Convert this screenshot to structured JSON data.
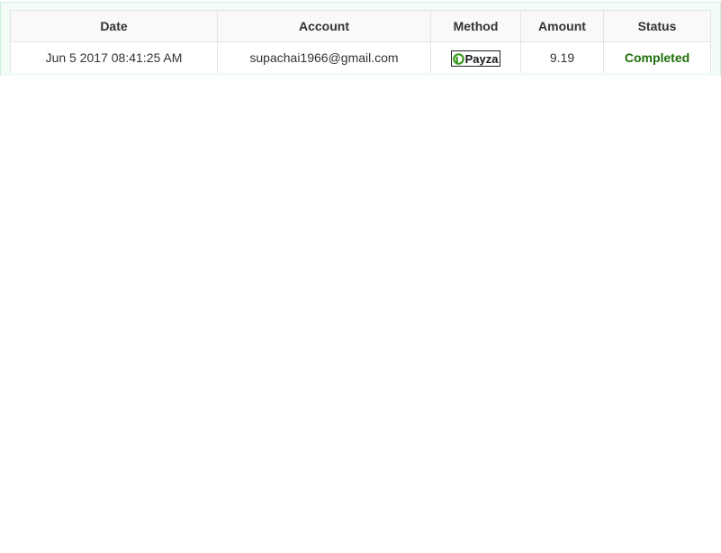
{
  "table": {
    "headers": {
      "date": "Date",
      "account": "Account",
      "method": "Method",
      "amount": "Amount",
      "status": "Status"
    },
    "rows": [
      {
        "date": "Jun 5 2017 08:41:25 AM",
        "account": "supachai1966@gmail.com",
        "method": {
          "logo_text": "Payza",
          "icon": "payza-logo-icon",
          "logo_color": "#3a9a1e"
        },
        "amount": "9.19",
        "status": "Completed"
      }
    ]
  },
  "colors": {
    "status_completed": "#1e6e0b",
    "panel_background": "#f3fbf7",
    "panel_border": "#cdeee0"
  }
}
